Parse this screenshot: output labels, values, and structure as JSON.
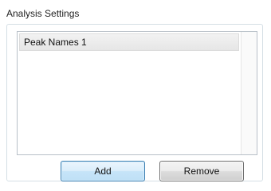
{
  "group": {
    "title": "Analysis Settings"
  },
  "list": {
    "items": [
      {
        "label": "Peak Names 1"
      }
    ]
  },
  "buttons": {
    "add_label": "Add",
    "remove_label": "Remove"
  }
}
